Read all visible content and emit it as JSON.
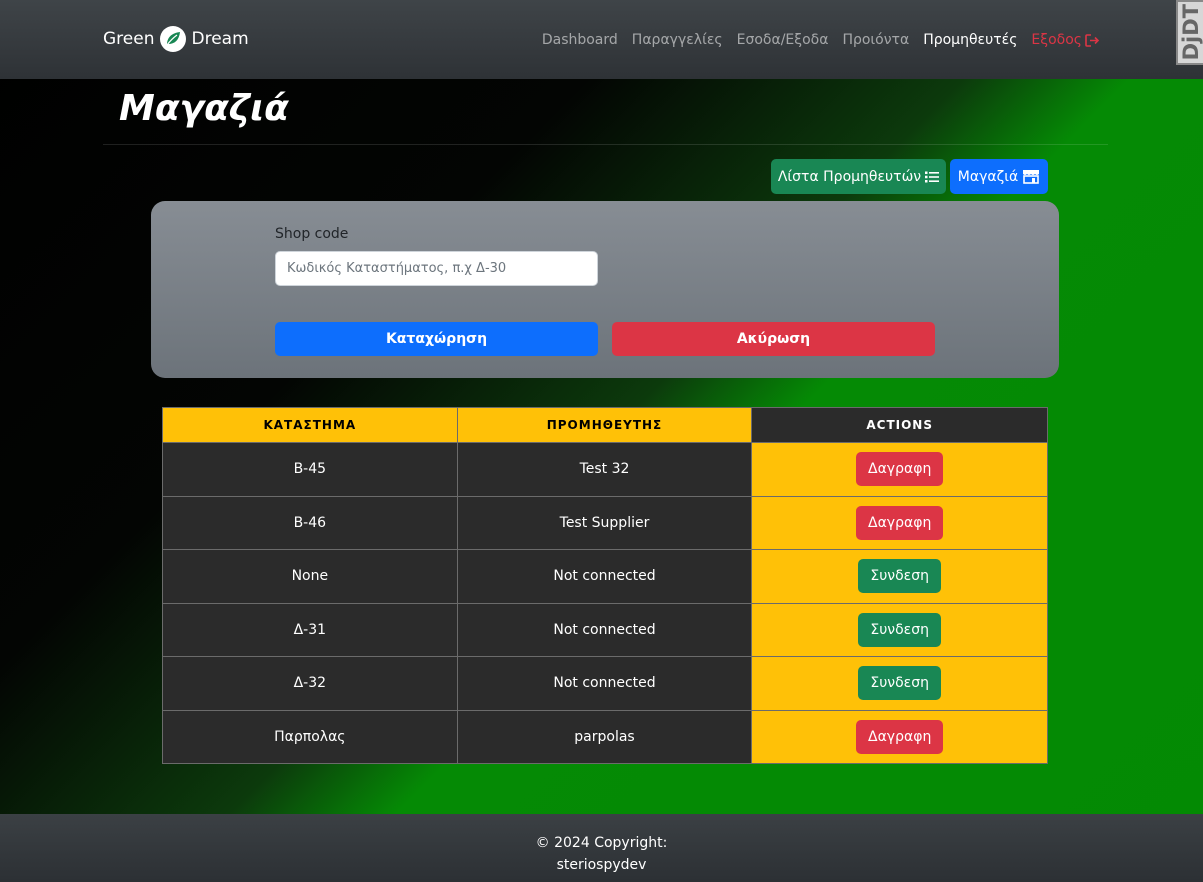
{
  "brand": {
    "name_left": "Green",
    "name_right": "Dream"
  },
  "nav": {
    "items": [
      {
        "label": "Dashboard"
      },
      {
        "label": "Παραγγελίες"
      },
      {
        "label": "Εσοδα/Εξοδα"
      },
      {
        "label": "Προιόντα"
      },
      {
        "label": "Προμηθευτές"
      }
    ],
    "logout_label": "Εξοδος",
    "active_item": "Προμηθευτές"
  },
  "debug_toolbar": {
    "label": "DjDT"
  },
  "page": {
    "title": "Μαγαζιά",
    "suppliers_list_button": "Λίστα Προμηθευτών",
    "shops_button": "Μαγαζιά"
  },
  "form": {
    "label": "Shop code",
    "placeholder": "Κωδικός Καταστήματος, π.χ Δ-30",
    "value": "",
    "submit_label": "Καταχώρηση",
    "cancel_label": "Ακύρωση"
  },
  "table": {
    "headers": [
      "ΚΑΤΑΣΤΗΜΑ",
      "ΠΡΟΜΗΘΕΥΤΗΣ",
      "ACTIONS"
    ],
    "rows": [
      {
        "shop": "B-45",
        "supplier": "Test 32",
        "action": "Δαγραφη",
        "action_type": "delete"
      },
      {
        "shop": "B-46",
        "supplier": "Test Supplier",
        "action": "Δαγραφη",
        "action_type": "delete"
      },
      {
        "shop": "None",
        "supplier": "Not connected",
        "action": "Συνδεση",
        "action_type": "connect"
      },
      {
        "shop": "Δ-31",
        "supplier": "Not connected",
        "action": "Συνδεση",
        "action_type": "connect"
      },
      {
        "shop": "Δ-32",
        "supplier": "Not connected",
        "action": "Συνδεση",
        "action_type": "connect"
      },
      {
        "shop": "Παρπολας",
        "supplier": "parpolas",
        "action": "Δαγραφη",
        "action_type": "delete"
      }
    ]
  },
  "footer": {
    "copyright": "© 2024 Copyright:",
    "author": "steriospydev"
  },
  "colors": {
    "primary": "#0d6efd",
    "success": "#198754",
    "danger": "#dc3545",
    "warning": "#ffc107",
    "dark_cell": "#2b2b2b"
  },
  "icons": {
    "brand_logo": "leaf-icon",
    "logout": "sign-out-icon",
    "suppliers_list": "list-icon",
    "shops": "store-icon"
  }
}
